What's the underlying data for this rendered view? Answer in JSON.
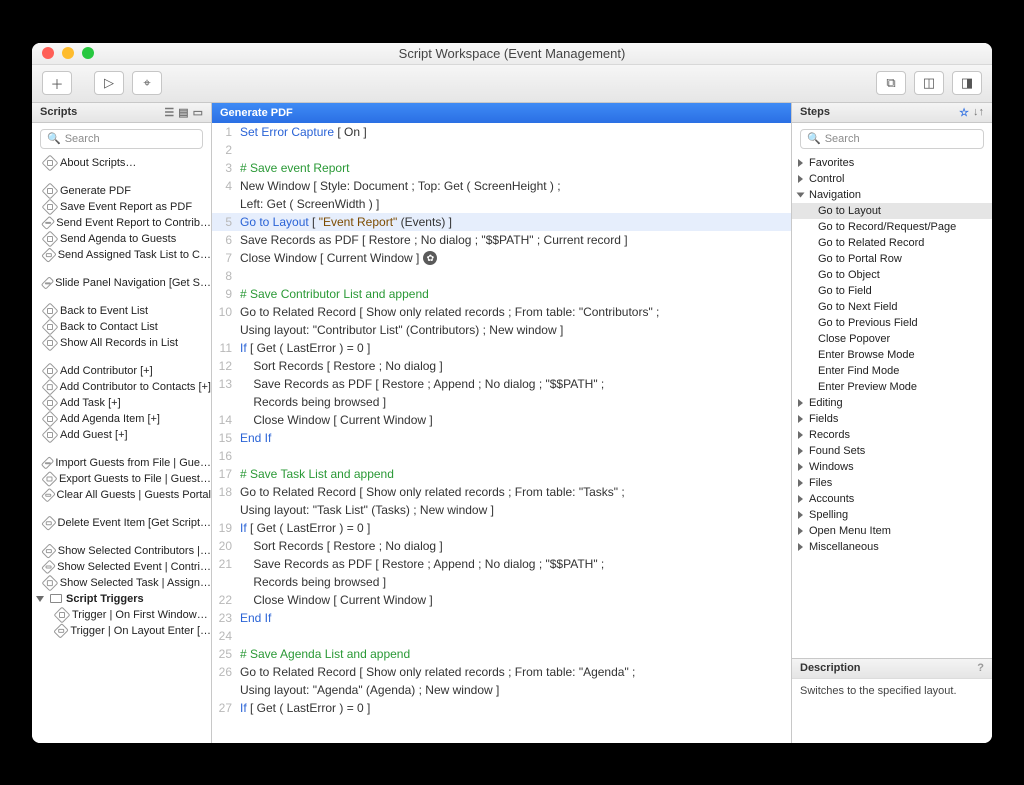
{
  "window": {
    "title": "Script Workspace (Event Management)"
  },
  "panels": {
    "scripts": "Scripts",
    "steps": "Steps",
    "description": "Description"
  },
  "search": {
    "placeholder": "Search"
  },
  "scripts": {
    "about": "About Scripts…",
    "items": [
      "Generate PDF",
      "Save Event Report as PDF",
      "Send Event Report to Contrib…",
      "Send Agenda to Guests",
      "Send Assigned Task List to C…"
    ],
    "group2": [
      "Slide Panel Navigation [Get S…"
    ],
    "group3": [
      "Back to Event List",
      "Back to Contact List",
      "Show All Records in List"
    ],
    "group4": [
      "Add Contributor [+]",
      "Add Contributor to Contacts [+]",
      "Add Task [+]",
      "Add Agenda Item [+]",
      "Add Guest [+]"
    ],
    "group5": [
      "Import Guests from File | Gue…",
      "Export Guests to File | Guest…",
      "Clear All Guests | Guests Portal"
    ],
    "group6": [
      "Delete Event Item [Get Script…"
    ],
    "group7": [
      "Show Selected Contributors |…",
      "Show Selected Event | Contri…",
      "Show Selected Task  | Assign…"
    ],
    "triggers_folder": "Script Triggers",
    "triggers": [
      "Trigger | On First Window…",
      "Trigger | On Layout Enter […"
    ]
  },
  "editor": {
    "tab": "Generate PDF",
    "lines": [
      {
        "n": 1,
        "type": "kw",
        "t": "Set Error Capture",
        "rest": " [ On ]"
      },
      {
        "n": 2,
        "type": "blank"
      },
      {
        "n": 3,
        "type": "cm",
        "t": "# Save event Report"
      },
      {
        "n": 4,
        "type": "plain",
        "t": "New Window [ Style: Document ; Top: Get ( ScreenHeight ) ;"
      },
      {
        "n": "",
        "type": "plain",
        "t": "Left: Get ( ScreenWidth ) ]"
      },
      {
        "n": 5,
        "type": "sel",
        "kw": "Go to Layout",
        "rest": " [ ",
        "st": "\"Event Report\"",
        "tail": " (Events) ]"
      },
      {
        "n": 6,
        "type": "plain",
        "t": "Save Records as PDF [ Restore ; No dialog ; \"$$PATH\" ; Current record ]"
      },
      {
        "n": 7,
        "type": "cog",
        "t": "Close Window [ Current Window ]"
      },
      {
        "n": 8,
        "type": "blank"
      },
      {
        "n": 9,
        "type": "cm",
        "t": "# Save Contributor List and append"
      },
      {
        "n": 10,
        "type": "plain",
        "t": "Go to Related Record [ Show only related records ; From table: \"Contributors\" ;"
      },
      {
        "n": "",
        "type": "plain",
        "t": "Using layout: \"Contributor List\" (Contributors) ; New window ]"
      },
      {
        "n": 11,
        "type": "kw",
        "t": "If",
        "rest": " [ Get ( LastError ) = 0 ]"
      },
      {
        "n": 12,
        "type": "indent",
        "t": "Sort Records [ Restore ; No dialog ]"
      },
      {
        "n": 13,
        "type": "indent",
        "t": "Save Records as PDF [ Restore ; Append ; No dialog ; \"$$PATH\" ;"
      },
      {
        "n": "",
        "type": "indent",
        "t": "Records being browsed ]"
      },
      {
        "n": 14,
        "type": "indent",
        "t": "Close Window [ Current Window ]"
      },
      {
        "n": 15,
        "type": "kw",
        "t": "End If"
      },
      {
        "n": 16,
        "type": "blank"
      },
      {
        "n": 17,
        "type": "cm",
        "t": "# Save Task List and append"
      },
      {
        "n": 18,
        "type": "plain",
        "t": "Go to Related Record [ Show only related records ; From table: \"Tasks\" ;"
      },
      {
        "n": "",
        "type": "plain",
        "t": "Using layout: \"Task List\" (Tasks) ; New window ]"
      },
      {
        "n": 19,
        "type": "kw",
        "t": "If",
        "rest": " [ Get ( LastError ) = 0 ]"
      },
      {
        "n": 20,
        "type": "indent",
        "t": "Sort Records [ Restore ; No dialog ]"
      },
      {
        "n": 21,
        "type": "indent",
        "t": "Save Records as PDF [ Restore ; Append ; No dialog ; \"$$PATH\" ;"
      },
      {
        "n": "",
        "type": "indent",
        "t": "Records being browsed ]"
      },
      {
        "n": 22,
        "type": "indent",
        "t": "Close Window [ Current Window ]"
      },
      {
        "n": 23,
        "type": "kw",
        "t": "End If"
      },
      {
        "n": 24,
        "type": "blank"
      },
      {
        "n": 25,
        "type": "cm",
        "t": "# Save Agenda List and append"
      },
      {
        "n": 26,
        "type": "plain",
        "t": "Go to Related Record [ Show only related records ; From table: \"Agenda\" ;"
      },
      {
        "n": "",
        "type": "plain",
        "t": "Using layout: \"Agenda\" (Agenda) ; New window ]"
      },
      {
        "n": 27,
        "type": "kw",
        "t": "If",
        "rest": " [ Get ( LastError ) = 0 ]"
      }
    ]
  },
  "steps": {
    "categories_top": [
      "Favorites",
      "Control"
    ],
    "navigation": "Navigation",
    "nav_items": [
      "Go to Layout",
      "Go to Record/Request/Page",
      "Go to Related Record",
      "Go to Portal Row",
      "Go to Object",
      "Go to Field",
      "Go to Next Field",
      "Go to Previous Field",
      "Close Popover",
      "Enter Browse Mode",
      "Enter Find Mode",
      "Enter Preview Mode"
    ],
    "categories_rest": [
      "Editing",
      "Fields",
      "Records",
      "Found Sets",
      "Windows",
      "Files",
      "Accounts",
      "Spelling",
      "Open Menu Item",
      "Miscellaneous"
    ]
  },
  "description": {
    "text": "Switches to the specified layout."
  }
}
